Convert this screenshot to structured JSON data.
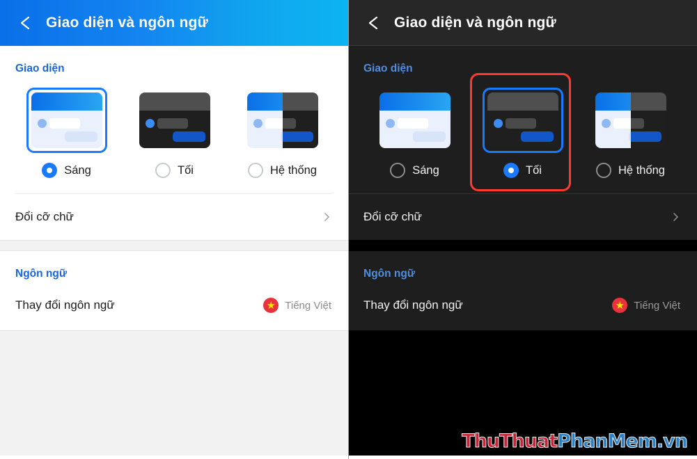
{
  "appbar": {
    "title": "Giao diện và ngôn ngữ",
    "back_icon": "chevron-left-icon"
  },
  "theme_section": {
    "title": "Giao diện",
    "options": [
      {
        "label": "Sáng",
        "thumb": "light-theme-thumbnail"
      },
      {
        "label": "Tối",
        "thumb": "dark-theme-thumbnail"
      },
      {
        "label": "Hệ thống",
        "thumb": "system-theme-thumbnail"
      }
    ],
    "font_size_row": {
      "label": "Đổi cỡ chữ",
      "chevron": "chevron-right-icon"
    }
  },
  "language_section": {
    "title": "Ngôn ngữ",
    "row": {
      "label": "Thay đổi ngôn ngữ",
      "value": "Tiếng Việt",
      "flag_icon": "vietnam-flag-icon",
      "flag_star": "★"
    }
  },
  "panels": {
    "left": {
      "mode": "light",
      "selected_theme": "Sáng"
    },
    "right": {
      "mode": "dark",
      "selected_theme": "Tối"
    }
  },
  "annotation": {
    "color": "#ff3b30",
    "target": "Tối"
  },
  "watermark": {
    "part1": "ThuThuat",
    "part2": "PhanMem.vn"
  },
  "colors": {
    "accent_blue": "#1a7aff",
    "header_blue_start": "#0a6fe8",
    "header_blue_end": "#0cb4f2",
    "section_blue_light": "#1666dd",
    "section_blue_dark": "#4e8fe0",
    "dark_appbar": "#272727",
    "dark_surface": "#1e1e1e",
    "light_filler": "#f2f2f2",
    "flag_red": "#e8323c",
    "flag_yellow": "#ffe400",
    "annotation_red": "#ff3b30"
  }
}
